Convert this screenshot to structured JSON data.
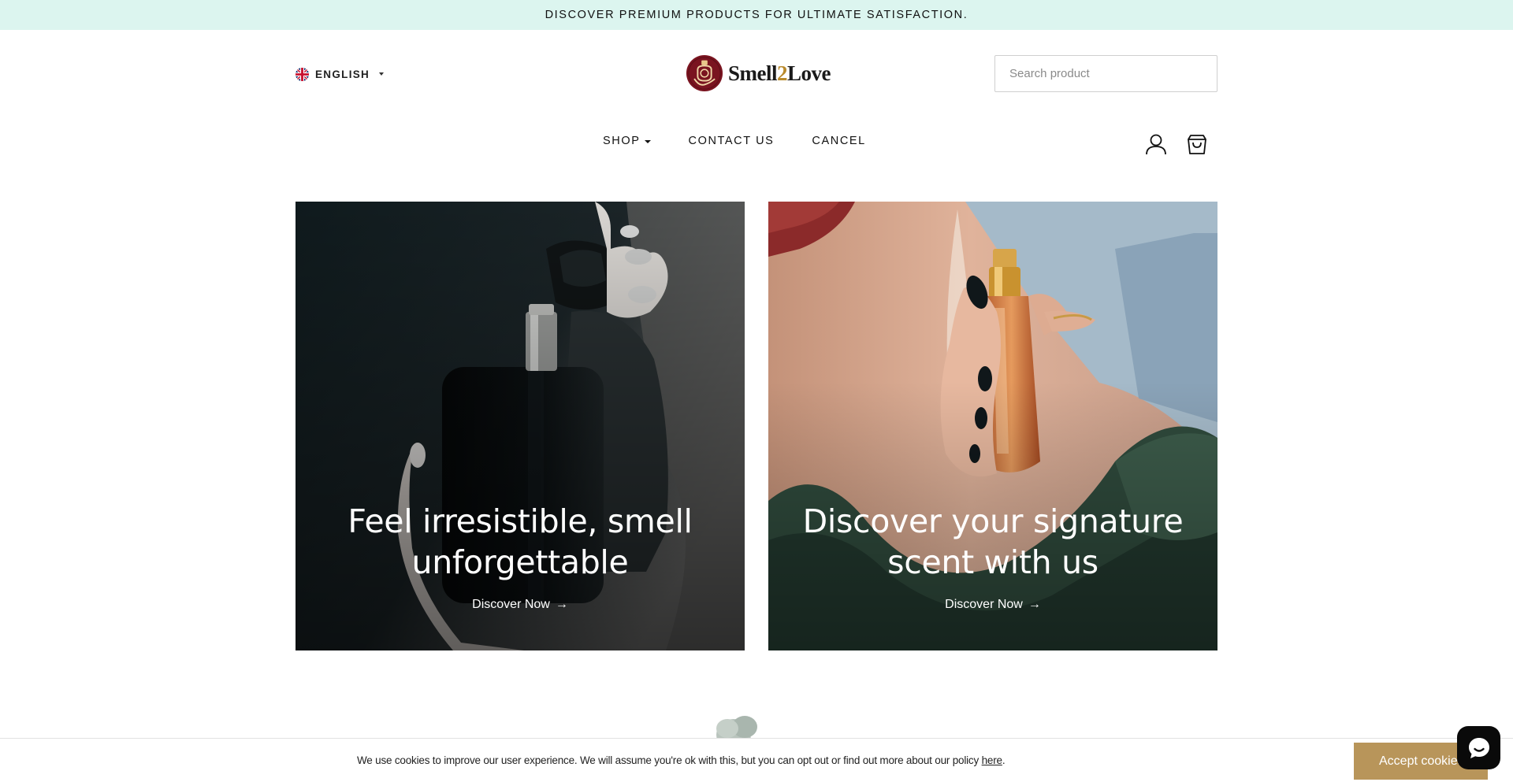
{
  "announcement": "DISCOVER PREMIUM PRODUCTS FOR ULTIMATE SATISFACTION.",
  "header": {
    "language": {
      "label": "ENGLISH",
      "flag_icon": "uk-flag-icon"
    },
    "logo": {
      "text_before": "Smell",
      "text_two": "2",
      "text_after": "Love",
      "brand_color": "#7a1420",
      "accent_color": "#b98a2c"
    },
    "search": {
      "placeholder": "Search product",
      "value": ""
    }
  },
  "nav": {
    "items": [
      {
        "label": "SHOP",
        "has_dropdown": true
      },
      {
        "label": "CONTACT US",
        "has_dropdown": false
      },
      {
        "label": "CANCEL",
        "has_dropdown": false
      }
    ],
    "account_icon": "user-icon",
    "cart_icon": "shopping-bag-icon"
  },
  "banners": [
    {
      "title": "Feel irresistible, smell unforgettable",
      "cta": "Discover Now",
      "arrow": "→"
    },
    {
      "title": "Discover your signature scent with us",
      "cta": "Discover Now",
      "arrow": "→"
    }
  ],
  "cookie_bar": {
    "text": "We use cookies to improve our user experience. We will assume you're ok with this, but you can opt out or find out more about our policy",
    "link": "here",
    "period": ".",
    "button": "Accept cookies"
  },
  "colors": {
    "announcement_bg": "#dcf5ef",
    "cookie_button": "#b8955a",
    "chat_button": "#0a0a0a"
  }
}
